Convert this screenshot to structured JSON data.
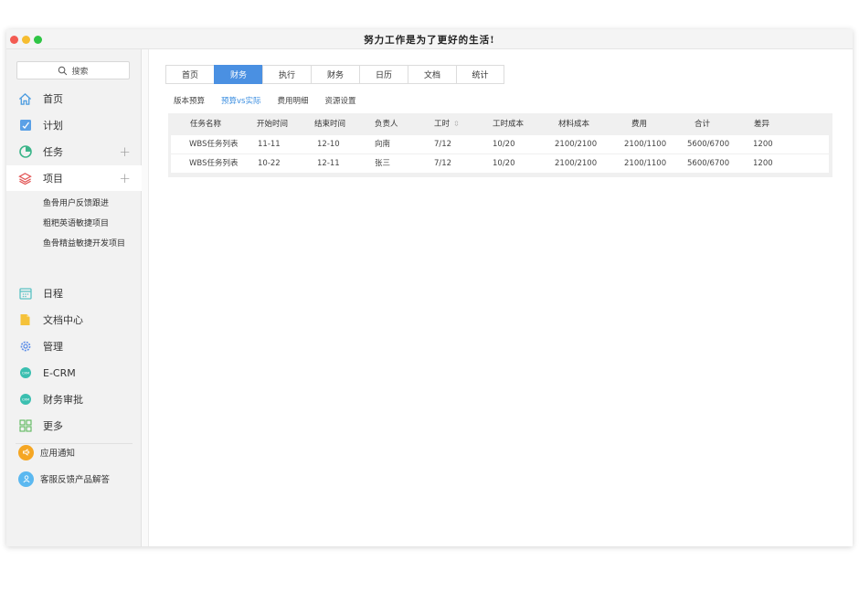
{
  "window": {
    "title": "努力工作是为了更好的生活!"
  },
  "sidebar": {
    "search_label": "搜索",
    "items": [
      {
        "label": "首页",
        "icon": "home-icon",
        "color": "#4a9be0"
      },
      {
        "label": "计划",
        "icon": "plan-icon",
        "color": "#5aa0e6"
      },
      {
        "label": "任务",
        "icon": "task-pie-icon",
        "color": "#3cb58a"
      },
      {
        "label": "项目",
        "icon": "layers-icon",
        "color": "#e25555"
      }
    ],
    "projects": [
      "鱼骨用户反馈跟进",
      "粗粑英语敏捷项目",
      "鱼骨精益敏捷开发项目"
    ],
    "more_items": [
      {
        "label": "日程",
        "icon": "calendar-icon",
        "color": "#5cc2c4"
      },
      {
        "label": "文档中心",
        "icon": "document-icon",
        "color": "#f5c23a"
      },
      {
        "label": "管理",
        "icon": "gear-icon",
        "color": "#5b8de8"
      },
      {
        "label": "E-CRM",
        "icon": "crm-icon",
        "color": "#3bbfb0",
        "glyph": "CRM"
      },
      {
        "label": "财务审批",
        "icon": "crm-icon",
        "color": "#3bbfb0",
        "glyph": "CRM"
      },
      {
        "label": "更多",
        "icon": "grid-icon",
        "color": "#5cb85c"
      }
    ],
    "bottom": [
      {
        "label": "应用通知",
        "icon": "speaker-icon",
        "color": "#f5a623"
      },
      {
        "label": "客服反馈产品解答",
        "icon": "user-icon",
        "color": "#5bb8f0"
      }
    ]
  },
  "main": {
    "tabs": [
      "首页",
      "财务",
      "执行",
      "财务",
      "日历",
      "文档",
      "统计"
    ],
    "active_tab": 1,
    "subtabs": [
      "版本预算",
      "预算vs实际",
      "费用明细",
      "资源设置"
    ],
    "active_subtab": 1,
    "table": {
      "headers": [
        "任务名称",
        "开始时间",
        "结束时间",
        "负责人",
        "工时",
        "工时成本",
        "材料成本",
        "费用",
        "合计",
        "差异"
      ],
      "rows": [
        [
          "WBS任务列表",
          "11-11",
          "12-10",
          "向南",
          "7/12",
          "10/20",
          "2100/2100",
          "2100/1100",
          "5600/6700",
          "1200"
        ],
        [
          "WBS任务列表",
          "10-22",
          "12-11",
          "张三",
          "7/12",
          "10/20",
          "2100/2100",
          "2100/1100",
          "5600/6700",
          "1200"
        ]
      ]
    }
  }
}
